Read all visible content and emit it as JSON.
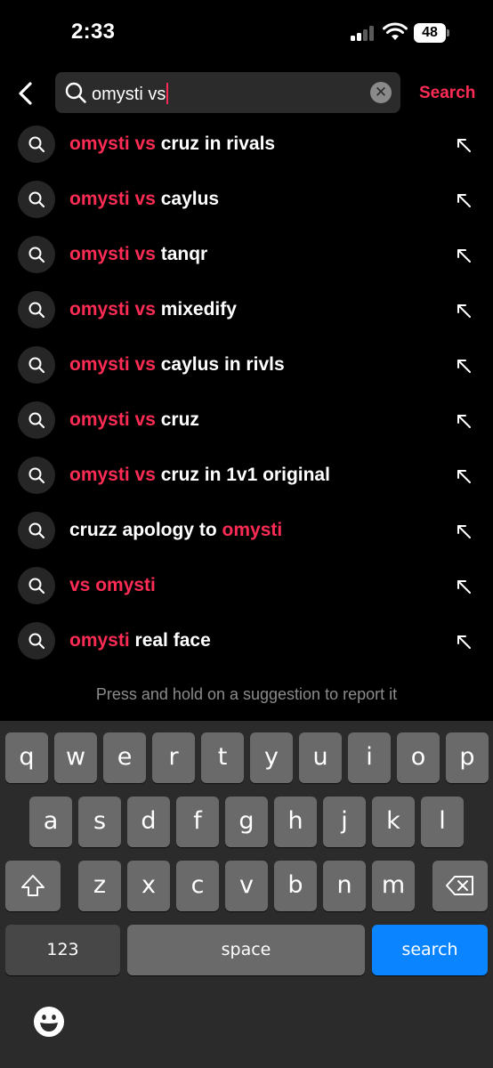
{
  "status_bar": {
    "time": "2:33",
    "battery": "48"
  },
  "search": {
    "value": "omysti vs",
    "clear_symbol": "✕",
    "submit_label": "Search"
  },
  "suggestions": [
    {
      "highlight": "omysti vs",
      "rest": " cruz in rivals"
    },
    {
      "highlight": "omysti vs",
      "rest": " caylus"
    },
    {
      "highlight": "omysti vs",
      "rest": " tanqr"
    },
    {
      "highlight": "omysti vs",
      "rest": " mixedify"
    },
    {
      "highlight": "omysti vs",
      "rest": " caylus in rivls"
    },
    {
      "highlight": "omysti vs",
      "rest": " cruz"
    },
    {
      "highlight": "omysti vs",
      "rest": " cruz in 1v1 original"
    },
    {
      "prefix": "cruzz apology to ",
      "highlight": "omysti"
    },
    {
      "highlight": "vs omysti"
    },
    {
      "highlight": "omysti",
      "rest": " real face"
    }
  ],
  "hint": "Press and hold on a suggestion to report it",
  "keyboard": {
    "row1": [
      "q",
      "w",
      "e",
      "r",
      "t",
      "y",
      "u",
      "i",
      "o",
      "p"
    ],
    "row2": [
      "a",
      "s",
      "d",
      "f",
      "g",
      "h",
      "j",
      "k",
      "l"
    ],
    "row3": [
      "z",
      "x",
      "c",
      "v",
      "b",
      "n",
      "m"
    ],
    "numbers_label": "123",
    "space_label": "space",
    "return_label": "search"
  },
  "colors": {
    "accent": "#fe2c55",
    "keyboard_blue": "#0a84ff",
    "background": "#000000"
  },
  "icons": [
    "back-chevron-icon",
    "search-icon",
    "clear-icon",
    "fill-arrow-icon",
    "shift-icon",
    "delete-icon",
    "emoji-icon",
    "wifi-icon",
    "signal-icon",
    "battery-icon"
  ]
}
